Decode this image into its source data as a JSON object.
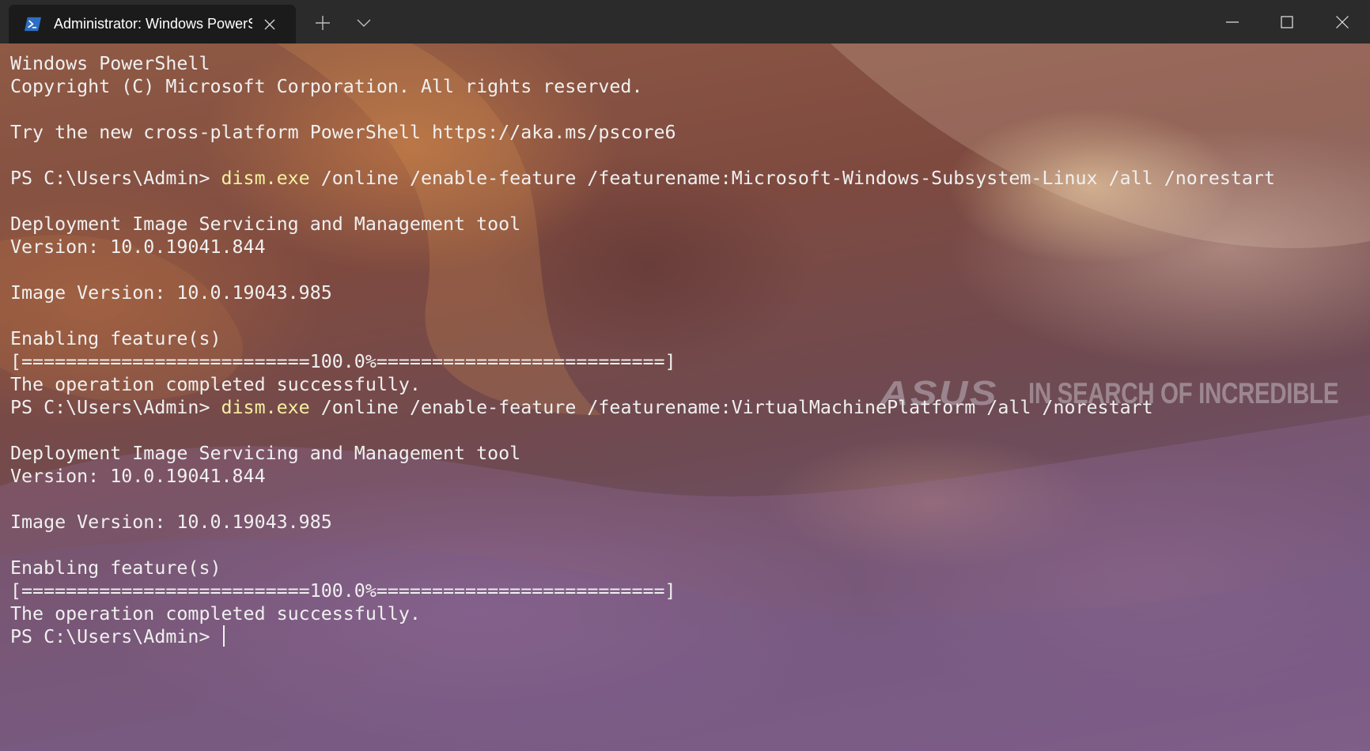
{
  "titlebar": {
    "tab": {
      "title": "Administrator: Windows PowerShell",
      "icon": "powershell-icon",
      "close_icon": "close-icon"
    },
    "new_tab_icon": "plus-icon",
    "dropdown_icon": "chevron-down-icon",
    "window_controls": [
      "minimize-icon",
      "maximize-icon",
      "close-icon"
    ]
  },
  "terminal": {
    "colors": {
      "text": "#f0f0f0",
      "command": "#f5f0a0",
      "titlebar": "#2b2b2b",
      "tab": "#1b1b1b"
    },
    "watermark": {
      "brand": "ASUS",
      "tagline": "IN SEARCH OF INCREDIBLE"
    },
    "lines": [
      {
        "text": "Windows PowerShell"
      },
      {
        "text": "Copyright (C) Microsoft Corporation. All rights reserved."
      },
      {
        "text": ""
      },
      {
        "text": "Try the new cross-platform PowerShell https://aka.ms/pscore6"
      },
      {
        "text": ""
      },
      {
        "prompt": "PS C:\\Users\\Admin> ",
        "command": "dism.exe",
        "args": " /online /enable-feature /featurename:Microsoft-Windows-Subsystem-Linux /all /norestart"
      },
      {
        "text": ""
      },
      {
        "text": "Deployment Image Servicing and Management tool"
      },
      {
        "text": "Version: 10.0.19041.844"
      },
      {
        "text": ""
      },
      {
        "text": "Image Version: 10.0.19043.985"
      },
      {
        "text": ""
      },
      {
        "text": "Enabling feature(s)"
      },
      {
        "text": "[==========================100.0%==========================]"
      },
      {
        "text": "The operation completed successfully."
      },
      {
        "prompt": "PS C:\\Users\\Admin> ",
        "command": "dism.exe",
        "args": " /online /enable-feature /featurename:VirtualMachinePlatform /all /norestart"
      },
      {
        "text": ""
      },
      {
        "text": "Deployment Image Servicing and Management tool"
      },
      {
        "text": "Version: 10.0.19041.844"
      },
      {
        "text": ""
      },
      {
        "text": "Image Version: 10.0.19043.985"
      },
      {
        "text": ""
      },
      {
        "text": "Enabling feature(s)"
      },
      {
        "text": "[==========================100.0%==========================]"
      },
      {
        "text": "The operation completed successfully."
      },
      {
        "prompt": "PS C:\\Users\\Admin> ",
        "cursor": true
      }
    ]
  }
}
